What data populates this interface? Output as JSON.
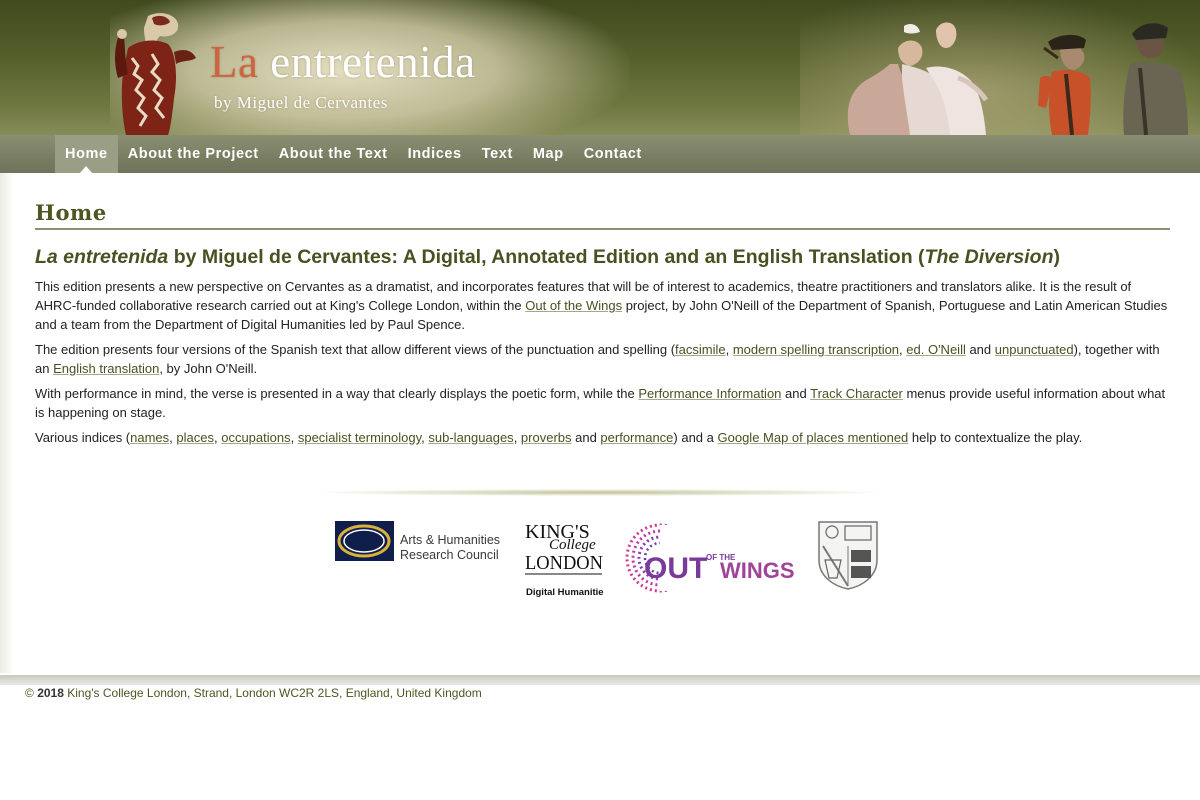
{
  "site": {
    "title_la": "La",
    "title_rest": "entretenida",
    "subtitle": "by Miguel de Cervantes"
  },
  "nav": {
    "items": [
      {
        "label": "Home",
        "active": true
      },
      {
        "label": "About the Project",
        "active": false
      },
      {
        "label": "About the Text",
        "active": false
      },
      {
        "label": "Indices",
        "active": false
      },
      {
        "label": "Text",
        "active": false
      },
      {
        "label": "Map",
        "active": false
      },
      {
        "label": "Contact",
        "active": false
      }
    ]
  },
  "page": {
    "heading": "Home",
    "main_heading": {
      "part1": "La entretenida",
      "part2": " by Miguel de Cervantes: A Digital, Annotated Edition and an English Translation (",
      "part3": "The Diversion",
      "part4": ")"
    },
    "p1": {
      "t1": "This edition presents a new perspective on Cervantes as a dramatist, and incorporates features that will be of interest to academics, theatre practitioners and translators alike. It is the result of AHRC-funded collaborative research carried out at King's College London, within the ",
      "link1": "Out of the Wings",
      "t2": " project, by John O'Neill of the Department of Spanish, Portuguese and Latin American Studies and a team from the Department of Digital Humanities led by Paul Spence."
    },
    "p2": {
      "t1": "The edition presents four versions of the Spanish text that allow different views of the punctuation and spelling (",
      "link1": "facsimile",
      "t2": ", ",
      "link2": "modern spelling transcription",
      "t3": ", ",
      "link3": "ed. O'Neill",
      "t4": " and ",
      "link4": "unpunctuated",
      "t5": "), together with an ",
      "link5": "English translation",
      "t6": ", by John O'Neill."
    },
    "p3": {
      "t1": "With performance in mind, the verse is presented in a way that clearly displays the poetic form, while the ",
      "link1": "Performance Information",
      "t2": " and ",
      "link2": "Track Character",
      "t3": " menus provide useful information about what is happening on stage."
    },
    "p4": {
      "t1": "Various indices (",
      "link1": "names",
      "t2": ", ",
      "link2": "places",
      "t3": ", ",
      "link3": "occupations",
      "t4": ", ",
      "link4": "specialist terminology",
      "t5": ", ",
      "link5": "sub-languages",
      "t6": ", ",
      "link6": "proverbs",
      "t7": " and ",
      "link7": "performance",
      "t8": ") and a ",
      "link8": "Google Map of places mentioned",
      "t9": " help to contextualize the play."
    }
  },
  "logos": {
    "ahrc_line1": "Arts & Humanities",
    "ahrc_line2": "Research Council",
    "kcl_line1": "KING'S",
    "kcl_line2": "College",
    "kcl_line3": "LONDON",
    "kcl_line4": "Digital Humanities",
    "otw_line1": "OUT",
    "otw_line2": "OF THE",
    "otw_line3": "WINGS"
  },
  "footer": {
    "copyright": "© ",
    "year": "2018",
    "address": " King's College London, Strand, London WC2R 2LS, England, United Kingdom"
  },
  "colors": {
    "banner": "#56612c",
    "nav": "#7a7f63",
    "heading": "#4a5021",
    "title_accent": "#cd6340"
  }
}
